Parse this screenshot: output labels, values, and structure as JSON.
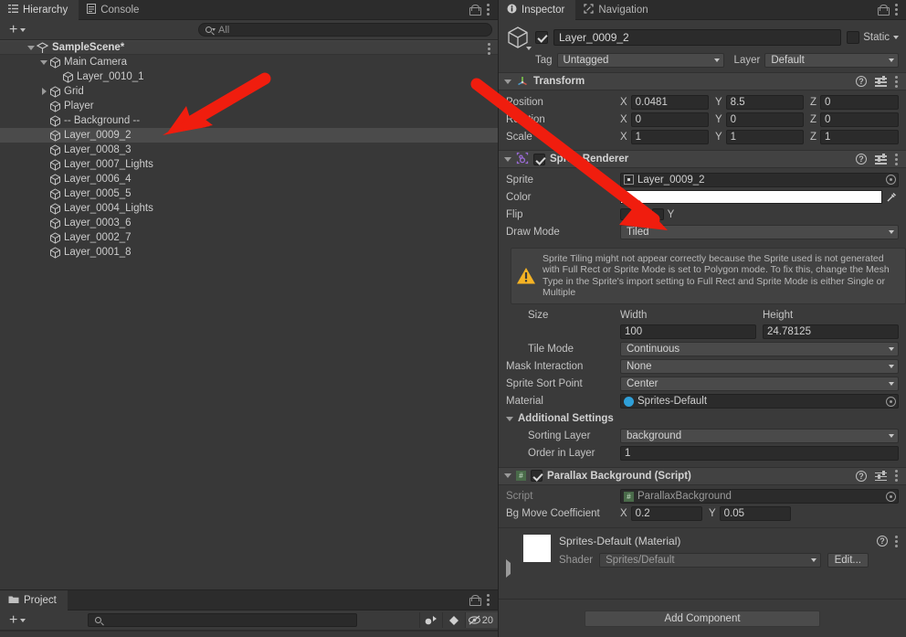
{
  "hierarchy": {
    "tabs": [
      {
        "label": "Hierarchy",
        "icon": "hierarchy-icon",
        "active": true
      },
      {
        "label": "Console",
        "icon": "console-icon",
        "active": false
      }
    ],
    "toolbar": {
      "add_label": "+",
      "search_placeholder": "All",
      "search_value": ""
    },
    "scene": {
      "label": "SampleScene*"
    },
    "items": [
      {
        "label": "Main Camera",
        "depth": 1,
        "foldout": "down",
        "selected": false
      },
      {
        "label": "Layer_0010_1",
        "depth": 2,
        "foldout": "none",
        "selected": false
      },
      {
        "label": "Grid",
        "depth": 1,
        "foldout": "right",
        "selected": false
      },
      {
        "label": "Player",
        "depth": 1,
        "foldout": "none",
        "selected": false
      },
      {
        "label": "-- Background --",
        "depth": 1,
        "foldout": "none",
        "selected": false
      },
      {
        "label": "Layer_0009_2",
        "depth": 1,
        "foldout": "none",
        "selected": true
      },
      {
        "label": "Layer_0008_3",
        "depth": 1,
        "foldout": "none",
        "selected": false
      },
      {
        "label": "Layer_0007_Lights",
        "depth": 1,
        "foldout": "none",
        "selected": false
      },
      {
        "label": "Layer_0006_4",
        "depth": 1,
        "foldout": "none",
        "selected": false
      },
      {
        "label": "Layer_0005_5",
        "depth": 1,
        "foldout": "none",
        "selected": false
      },
      {
        "label": "Layer_0004_Lights",
        "depth": 1,
        "foldout": "none",
        "selected": false
      },
      {
        "label": "Layer_0003_6",
        "depth": 1,
        "foldout": "none",
        "selected": false
      },
      {
        "label": "Layer_0002_7",
        "depth": 1,
        "foldout": "none",
        "selected": false
      },
      {
        "label": "Layer_0001_8",
        "depth": 1,
        "foldout": "none",
        "selected": false
      }
    ]
  },
  "project": {
    "tabs": [
      {
        "label": "Project",
        "icon": "folder-icon",
        "active": true
      }
    ],
    "toolbar": {
      "add_label": "+",
      "search_placeholder": "",
      "search_value": "",
      "visibility_count": "20"
    }
  },
  "inspector": {
    "tabs": [
      {
        "label": "Inspector",
        "icon": "info-icon",
        "active": true
      },
      {
        "label": "Navigation",
        "icon": "navigation-icon",
        "active": false
      }
    ],
    "object": {
      "enabled": true,
      "name": "Layer_0009_2",
      "static_label": "Static",
      "static_checked": false,
      "tag_label": "Tag",
      "tag_value": "Untagged",
      "layer_label": "Layer",
      "layer_value": "Default"
    },
    "transform": {
      "title": "Transform",
      "rows": [
        {
          "label": "Position",
          "x": "0.0481",
          "y": "8.5",
          "z": "0"
        },
        {
          "label": "Rotation",
          "x": "0",
          "y": "0",
          "z": "0"
        },
        {
          "label": "Scale",
          "x": "1",
          "y": "1",
          "z": "1"
        }
      ],
      "axis_labels": [
        "X",
        "Y",
        "Z"
      ]
    },
    "sprite_renderer": {
      "title": "Sprite Renderer",
      "enabled": true,
      "sprite_label": "Sprite",
      "sprite_value": "Layer_0009_2",
      "color_label": "Color",
      "color_value": "#FFFFFF",
      "flip_label": "Flip",
      "flip_x_label": "X",
      "flip_y_label": "Y",
      "flip_x": false,
      "flip_y": false,
      "draw_mode_label": "Draw Mode",
      "draw_mode_value": "Tiled",
      "warning": "Sprite Tiling might not appear correctly because the Sprite used is not generated with Full Rect or Sprite Mode is set to Polygon mode. To fix this, change the Mesh Type in the Sprite's import setting to Full Rect and Sprite Mode is either Single or Multiple",
      "size_label": "Size",
      "width_label": "Width",
      "height_label": "Height",
      "width_value": "100",
      "height_value": "24.78125",
      "tile_mode_label": "Tile Mode",
      "tile_mode_value": "Continuous",
      "mask_interaction_label": "Mask Interaction",
      "mask_interaction_value": "None",
      "sort_point_label": "Sprite Sort Point",
      "sort_point_value": "Center",
      "material_label": "Material",
      "material_value": "Sprites-Default",
      "additional_settings_label": "Additional Settings",
      "sorting_layer_label": "Sorting Layer",
      "sorting_layer_value": "background",
      "order_in_layer_label": "Order in Layer",
      "order_in_layer_value": "1"
    },
    "parallax_script": {
      "title": "Parallax Background (Script)",
      "enabled": true,
      "script_label": "Script",
      "script_value": "ParallaxBackground",
      "coefficient_label": "Bg Move Coefficient",
      "coefficient_x_axis": "X",
      "coefficient_y_axis": "Y",
      "coefficient_x": "0.2",
      "coefficient_y": "0.05"
    },
    "material_preview": {
      "title": "Sprites-Default (Material)",
      "shader_label": "Shader",
      "shader_value": "Sprites/Default",
      "edit_label": "Edit..."
    },
    "add_component_label": "Add Component"
  },
  "annotations": {
    "arrow_color": "#f01d0e",
    "arrows": [
      {
        "name": "arrow-to-hierarchy-selection"
      },
      {
        "name": "arrow-to-draw-mode"
      }
    ]
  }
}
